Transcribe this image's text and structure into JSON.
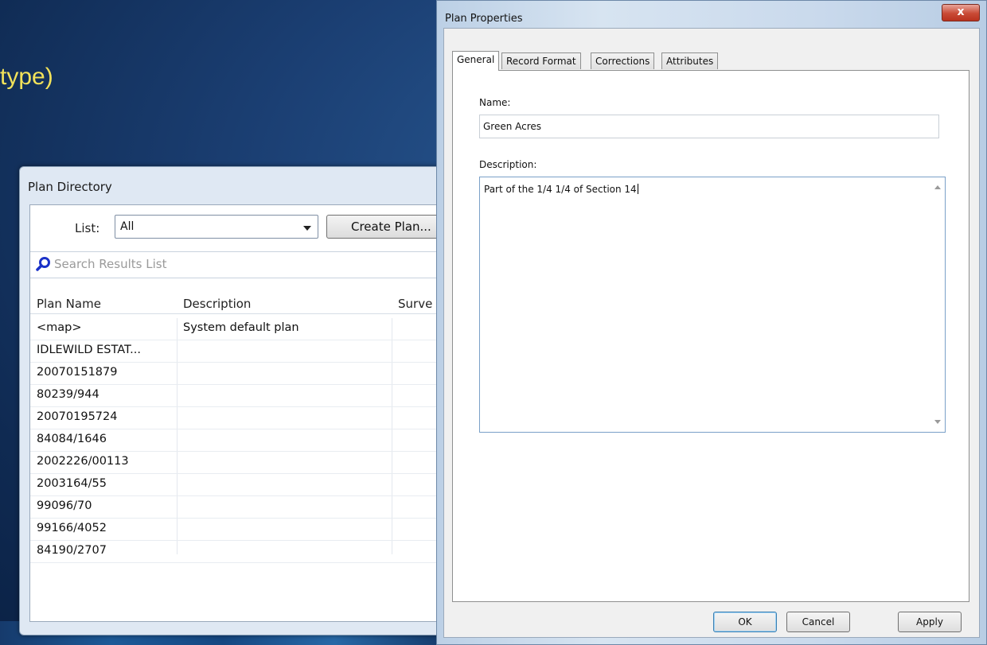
{
  "slide": {
    "title_fragment": "type)"
  },
  "plan_directory": {
    "title": "Plan Directory",
    "list_label": "List:",
    "list_value": "All",
    "create_button": "Create Plan...",
    "search_placeholder": "Search Results List",
    "columns": [
      "Plan Name",
      "Description",
      "Surve"
    ],
    "rows": [
      {
        "name": "<map>",
        "description": "System default plan"
      },
      {
        "name": "IDLEWILD ESTAT...",
        "description": ""
      },
      {
        "name": "20070151879",
        "description": ""
      },
      {
        "name": "80239/944",
        "description": ""
      },
      {
        "name": "20070195724",
        "description": ""
      },
      {
        "name": "84084/1646",
        "description": ""
      },
      {
        "name": "2002226/00113",
        "description": ""
      },
      {
        "name": "2003164/55",
        "description": ""
      },
      {
        "name": "99096/70",
        "description": ""
      },
      {
        "name": "99166/4052",
        "description": ""
      },
      {
        "name": "84190/2707",
        "description": ""
      }
    ]
  },
  "plan_properties": {
    "title": "Plan Properties",
    "close_glyph": "x",
    "tabs": [
      {
        "label": "General"
      },
      {
        "label": "Record Format"
      },
      {
        "label": "Corrections"
      },
      {
        "label": "Attributes"
      }
    ],
    "name_label": "Name:",
    "name_value": "Green Acres",
    "description_label": "Description:",
    "description_value": "Part of the 1/4 1/4 of Section 14",
    "buttons": {
      "ok": "OK",
      "cancel": "Cancel",
      "apply": "Apply"
    }
  }
}
